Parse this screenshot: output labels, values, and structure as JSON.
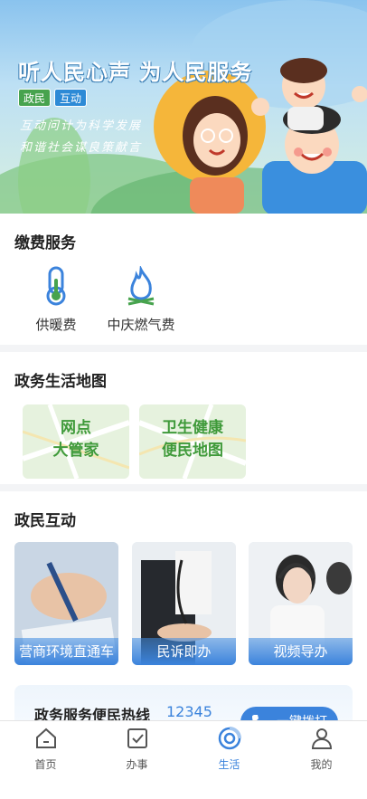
{
  "banner": {
    "title": "听人民心声 为人民服务",
    "tags": [
      "政民",
      "互动"
    ],
    "slogan_line1": "互动问计为科学发展",
    "slogan_line2": "和谐社会谋良策献言"
  },
  "payment": {
    "title": "缴费服务",
    "items": [
      {
        "label": "供暖费",
        "icon": "thermometer-icon"
      },
      {
        "label": "中庆燃气费",
        "icon": "gas-flame-icon"
      }
    ]
  },
  "map": {
    "title": "政务生活地图",
    "cards": [
      {
        "line1": "网点",
        "line2": "大管家"
      },
      {
        "line1": "卫生健康",
        "line2": "便民地图"
      }
    ]
  },
  "interaction": {
    "title": "政民互动",
    "cards": [
      {
        "label": "营商环境直通车"
      },
      {
        "label": "民诉即办"
      },
      {
        "label": "视频导办"
      }
    ],
    "hotline": {
      "label": "政务服务便民热线",
      "number": "12345",
      "call_label": "一键拨打"
    }
  },
  "tabbar": {
    "active": "生活",
    "items": [
      {
        "label": "首页",
        "icon": "home-icon"
      },
      {
        "label": "办事",
        "icon": "checkbox-icon"
      },
      {
        "label": "生活",
        "icon": "life-ring-icon"
      },
      {
        "label": "我的",
        "icon": "user-icon"
      }
    ]
  },
  "colors": {
    "accent": "#3b83dc",
    "green": "#47a34e",
    "map_text": "#3f9a3a"
  }
}
